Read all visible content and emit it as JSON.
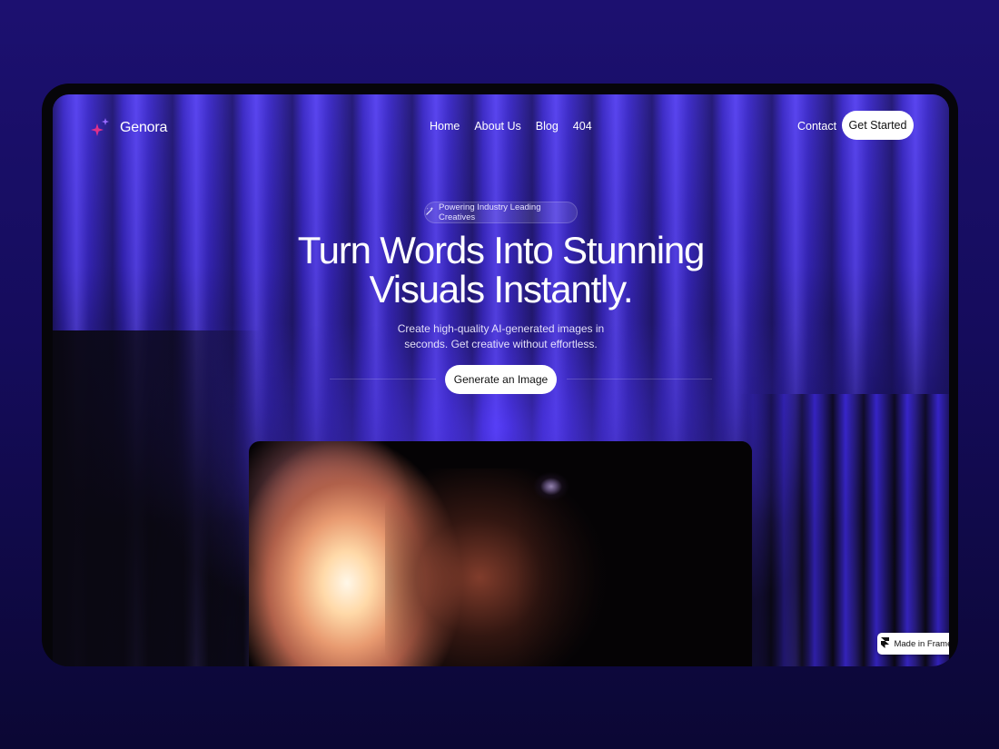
{
  "brand": {
    "name": "Genora"
  },
  "nav": {
    "items": [
      "Home",
      "About Us",
      "Blog",
      "404"
    ],
    "contact": "Contact",
    "cta": "Get Started"
  },
  "hero": {
    "badge": "Powering Industry Leading Creatives",
    "headline_line1": "Turn Words Into Stunning",
    "headline_line2": "Visuals Instantly.",
    "sub_line1": "Create high-quality AI-generated images in",
    "sub_line2": "seconds.  Get creative without effortless.",
    "cta": "Generate an Image"
  },
  "footer_badge": "Made in Framer",
  "colors": {
    "accent": "#4a36e8",
    "logo_pink": "#e0308a",
    "logo_purple": "#9a6bff"
  }
}
